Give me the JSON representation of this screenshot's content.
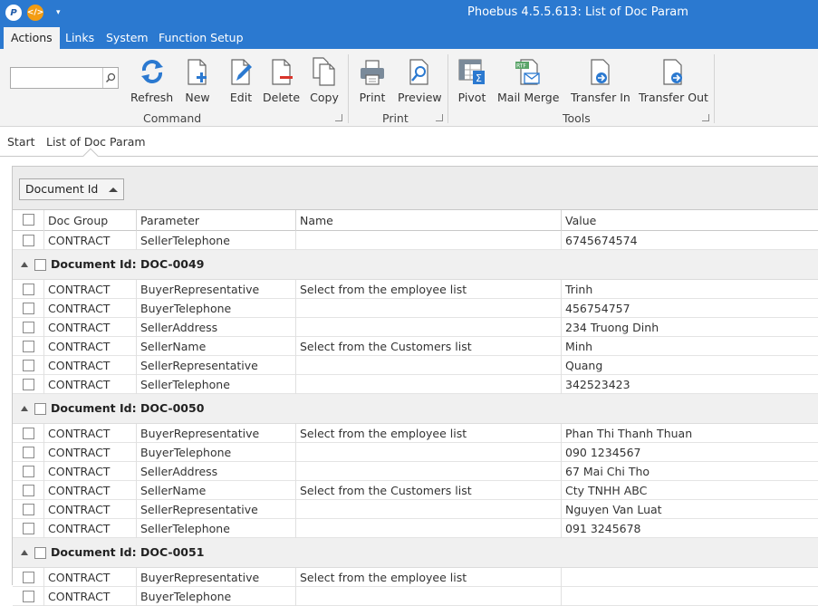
{
  "window": {
    "title": "Phoebus 4.5.5.613: List of Doc Param"
  },
  "menu": {
    "tabs": [
      "Actions",
      "Links",
      "System",
      "Function Setup"
    ],
    "active": "Actions"
  },
  "ribbon": {
    "search": {
      "value": "",
      "placeholder": ""
    },
    "command": {
      "label": "Command",
      "buttons": [
        "Refresh",
        "New",
        "Edit",
        "Delete",
        "Copy"
      ]
    },
    "print": {
      "label": "Print",
      "buttons": [
        "Print",
        "Preview"
      ]
    },
    "tools": {
      "label": "Tools",
      "buttons": [
        "Pivot",
        "Mail Merge",
        "Transfer In",
        "Transfer Out"
      ]
    }
  },
  "breadcrumb": {
    "items": [
      "Start",
      "List of Doc Param"
    ]
  },
  "grid": {
    "group_by": "Document Id",
    "columns": [
      "Doc Group",
      "Parameter",
      "Name",
      "Value"
    ],
    "top_row": {
      "doc_group": "CONTRACT",
      "parameter": "SellerTelephone",
      "name": "",
      "value": "6745674574"
    },
    "groups": [
      {
        "title": "Document Id: DOC-0049",
        "rows": [
          {
            "doc_group": "CONTRACT",
            "parameter": "BuyerRepresentative",
            "name": "Select from the employee list",
            "value": "Trinh"
          },
          {
            "doc_group": "CONTRACT",
            "parameter": "BuyerTelephone",
            "name": "",
            "value": "456754757"
          },
          {
            "doc_group": "CONTRACT",
            "parameter": "SellerAddress",
            "name": "",
            "value": "234 Truong Dinh"
          },
          {
            "doc_group": "CONTRACT",
            "parameter": "SellerName",
            "name": "Select from the Customers list",
            "value": "Minh"
          },
          {
            "doc_group": "CONTRACT",
            "parameter": "SellerRepresentative",
            "name": "",
            "value": "Quang"
          },
          {
            "doc_group": "CONTRACT",
            "parameter": "SellerTelephone",
            "name": "",
            "value": "342523423"
          }
        ]
      },
      {
        "title": "Document Id: DOC-0050",
        "rows": [
          {
            "doc_group": "CONTRACT",
            "parameter": "BuyerRepresentative",
            "name": "Select from the employee list",
            "value": "Phan Thi Thanh Thuan"
          },
          {
            "doc_group": "CONTRACT",
            "parameter": "BuyerTelephone",
            "name": "",
            "value": "090 1234567"
          },
          {
            "doc_group": "CONTRACT",
            "parameter": "SellerAddress",
            "name": "",
            "value": "67 Mai Chi Tho"
          },
          {
            "doc_group": "CONTRACT",
            "parameter": "SellerName",
            "name": "Select from the Customers list",
            "value": "Cty TNHH ABC"
          },
          {
            "doc_group": "CONTRACT",
            "parameter": "SellerRepresentative",
            "name": "",
            "value": "Nguyen Van Luat"
          },
          {
            "doc_group": "CONTRACT",
            "parameter": "SellerTelephone",
            "name": "",
            "value": "091 3245678"
          }
        ]
      },
      {
        "title": "Document Id: DOC-0051",
        "rows": [
          {
            "doc_group": "CONTRACT",
            "parameter": "BuyerRepresentative",
            "name": "Select from the employee list",
            "value": ""
          },
          {
            "doc_group": "CONTRACT",
            "parameter": "BuyerTelephone",
            "name": "",
            "value": ""
          }
        ]
      }
    ]
  },
  "colors": {
    "accent": "#2b79d0",
    "ribbon_bg": "#f3f3f3",
    "group_row_bg": "#f0f0f0"
  }
}
